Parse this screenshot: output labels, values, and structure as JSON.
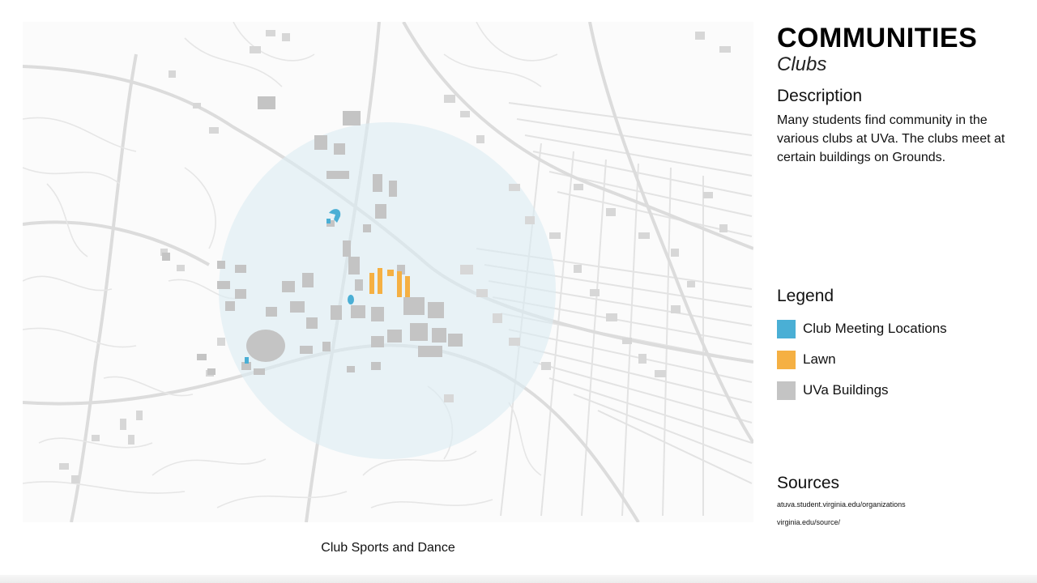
{
  "header": {
    "title": "COMMUNITIES",
    "subtitle": "Clubs"
  },
  "description": {
    "heading": "Description",
    "text": "Many students find community in the various clubs at UVa. The clubs meet at certain buildings on Grounds."
  },
  "legend": {
    "heading": "Legend",
    "items": [
      {
        "label": "Club Meeting Locations",
        "color": "#4aafd5"
      },
      {
        "label": "Lawn",
        "color": "#f5b043"
      },
      {
        "label": "UVa Buildings",
        "color": "#c4c4c4"
      }
    ]
  },
  "sources": {
    "heading": "Sources",
    "items": [
      "atuva.student.virginia.edu/organizations",
      "virginia.edu/source/"
    ]
  },
  "map": {
    "caption": "Club Sports and Dance",
    "colors": {
      "background": "#fbfbfb",
      "roads": "#e3e3e3",
      "buffer": "#e6f1f6",
      "buildings": "#c4c4c4",
      "club_locations": "#4aafd5",
      "lawn": "#f5b043"
    }
  }
}
